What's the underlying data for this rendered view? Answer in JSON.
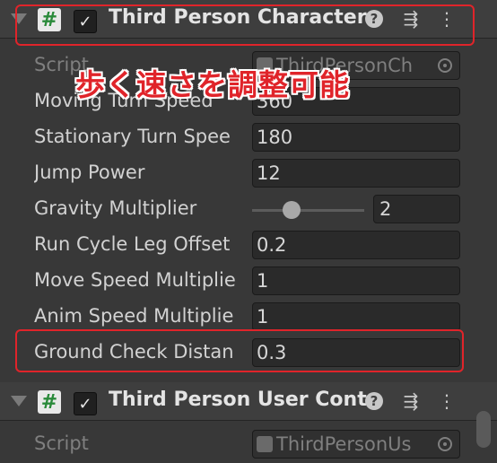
{
  "component1": {
    "enabled_check": "✓",
    "icon_glyph": "#",
    "title": "Third Person Character",
    "help": "?",
    "settings": "⇶",
    "menu": "⋮"
  },
  "properties": [
    {
      "label": "Script",
      "value": "ThirdPersonCh",
      "disabled": true
    },
    {
      "label": "Moving Turn Speed",
      "value": "360"
    },
    {
      "label": "Stationary Turn Spee",
      "value": "180"
    },
    {
      "label": "Jump Power",
      "value": "12"
    },
    {
      "label": "Gravity Multiplier",
      "value": "2",
      "slider_fraction": 0.35
    },
    {
      "label": "Run Cycle Leg Offset",
      "value": "0.2"
    },
    {
      "label": "Move Speed Multiplie",
      "value": "1"
    },
    {
      "label": "Anim Speed Multiplie",
      "value": "1"
    },
    {
      "label": "Ground Check Distan",
      "value": "0.3"
    }
  ],
  "annotation": "歩く速さを調整可能",
  "component2": {
    "enabled_check": "✓",
    "icon_glyph": "#",
    "title": "Third Person User Cont",
    "help": "?",
    "settings": "⇶",
    "menu": "⋮",
    "script_label": "Script",
    "script_value": "ThirdPersonUs"
  },
  "colors": {
    "highlight": "#e0242a",
    "background": "#383838"
  }
}
